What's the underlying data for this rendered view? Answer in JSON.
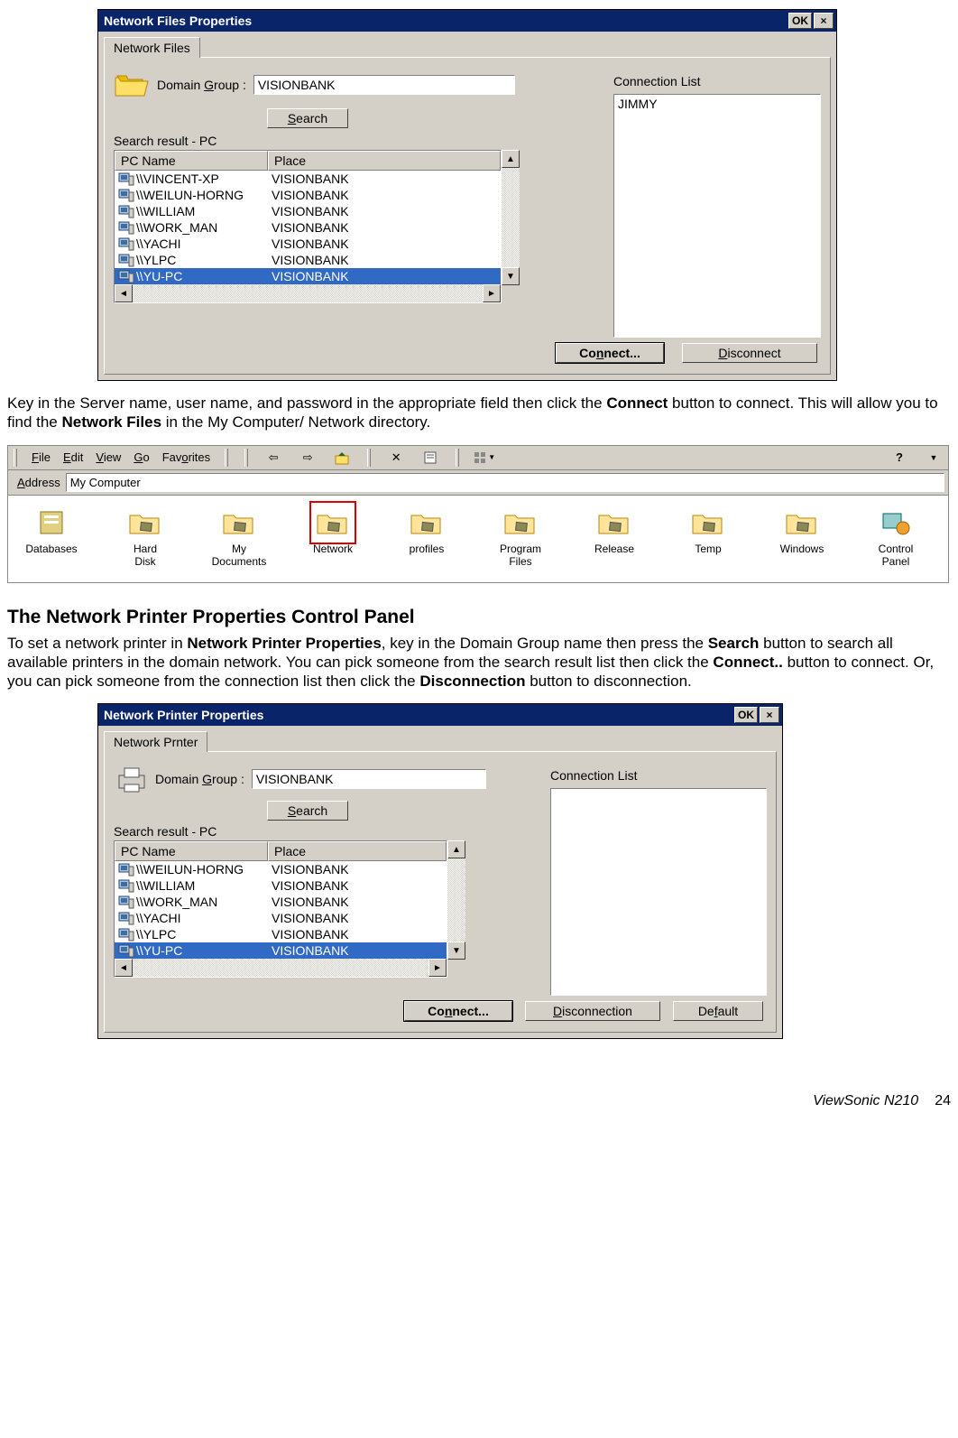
{
  "dialog1": {
    "title": "Network Files Properties",
    "ok": "OK",
    "close": "×",
    "tab": "Network Files",
    "domain_group_label_pre": "Domain ",
    "domain_group_label_u": "G",
    "domain_group_label_post": "roup :",
    "domain_group_value": "VISIONBANK",
    "search_btn_u": "S",
    "search_btn_post": "earch",
    "connection_list": "Connection List",
    "conn_items": [
      "JIMMY"
    ],
    "search_result_label": "Search result - PC",
    "col_pc": "PC Name",
    "col_place": "Place",
    "rows": [
      {
        "pc": "\\\\VINCENT-XP",
        "place": "VISIONBANK"
      },
      {
        "pc": "\\\\WEILUN-HORNG",
        "place": "VISIONBANK"
      },
      {
        "pc": "\\\\WILLIAM",
        "place": "VISIONBANK"
      },
      {
        "pc": "\\\\WORK_MAN",
        "place": "VISIONBANK"
      },
      {
        "pc": "\\\\YACHI",
        "place": "VISIONBANK"
      },
      {
        "pc": "\\\\YLPC",
        "place": "VISIONBANK"
      },
      {
        "pc": "\\\\YU-PC",
        "place": "VISIONBANK"
      }
    ],
    "connect_btn_pre": "Co",
    "connect_btn_u": "n",
    "connect_btn_post": "nect...",
    "disconnect_btn_u": "D",
    "disconnect_btn_post": "isconnect"
  },
  "para1_a": "Key in the Server name, user name, and password in the appropriate field then click the ",
  "para1_b": "Connect",
  "para1_c": " button to connect. This will allow you to find the ",
  "para1_d": "Network Files",
  "para1_e": " in the My Computer/ Network directory.",
  "explorer": {
    "menus_u": [
      "F",
      "E",
      "V",
      "G",
      "o"
    ],
    "menus_full": [
      "File",
      "Edit",
      "View",
      "Go",
      "Favorites"
    ],
    "addr_label_u": "A",
    "addr_label_post": "ddress",
    "addr_value": "My Computer",
    "icons": [
      "Databases",
      "Hard Disk",
      "My Documents",
      "Network",
      "profiles",
      "Program Files",
      "Release",
      "Temp",
      "Windows",
      "Control Panel"
    ]
  },
  "heading2": "The Network Printer Properties Control Panel",
  "para2_a": "To set a network printer in ",
  "para2_b": "Network Printer Properties",
  "para2_c": ", key in the Domain Group name then press the ",
  "para2_d": "Search",
  "para2_e": " button to search all available printers in the domain network. You can pick someone from the search result list then click the ",
  "para2_f": "Connect..",
  "para2_g": " button to connect. Or, you can pick someone from the connection list then click the ",
  "para2_h": "Disconnection",
  "para2_i": " button to disconnection.",
  "dialog2": {
    "title": "Network Printer Properties",
    "ok": "OK",
    "close": "×",
    "tab": "Network Prnter",
    "domain_group_label_pre": "Domain ",
    "domain_group_label_u": "G",
    "domain_group_label_post": "roup :",
    "domain_group_value": "VISIONBANK",
    "search_btn_u": "S",
    "search_btn_post": "earch",
    "connection_list": "Connection List",
    "search_result_label": "Search result - PC",
    "col_pc": "PC Name",
    "col_place": "Place",
    "rows": [
      {
        "pc": "\\\\WEILUN-HORNG",
        "place": "VISIONBANK"
      },
      {
        "pc": "\\\\WILLIAM",
        "place": "VISIONBANK"
      },
      {
        "pc": "\\\\WORK_MAN",
        "place": "VISIONBANK"
      },
      {
        "pc": "\\\\YACHI",
        "place": "VISIONBANK"
      },
      {
        "pc": "\\\\YLPC",
        "place": "VISIONBANK"
      },
      {
        "pc": "\\\\YU-PC",
        "place": "VISIONBANK"
      }
    ],
    "connect_btn_pre": "Co",
    "connect_btn_u": "n",
    "connect_btn_post": "nect...",
    "disconnection_btn_u": "D",
    "disconnection_btn_post": "isconnection",
    "default_btn_pre": "De",
    "default_btn_u": "f",
    "default_btn_post": "ault"
  },
  "footer_brand": "ViewSonic   N210",
  "footer_page": "24"
}
